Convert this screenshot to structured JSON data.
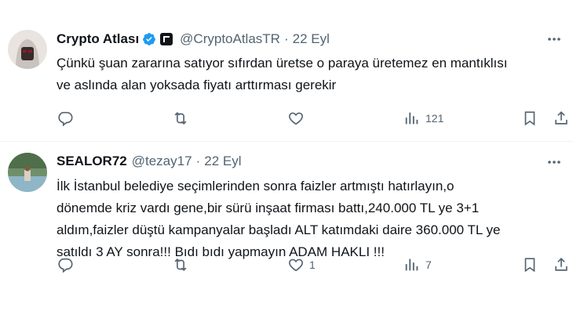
{
  "tweets": [
    {
      "name": "Crypto Atlası",
      "handle": "@CryptoAtlasTR",
      "separator": "·",
      "date": "22 Eyl",
      "text_lines": [
        "Çünkü şuan zararına satıyor sıfırdan üretse o paraya üretemez en mantıklısı",
        "ve aslında alan yoksada fiyatı arttırması gerekir"
      ],
      "verified": true,
      "affiliate_badge": true,
      "actions": {
        "replies": "",
        "retweets": "",
        "likes": "",
        "views": "121"
      }
    },
    {
      "name": "SEALOR72",
      "handle": "@tezay17",
      "separator": "·",
      "date": "22 Eyl",
      "text_lines": [
        "İlk İstanbul belediye seçimlerinden sonra faizler artmıştı hatırlayın,o",
        "dönemde kriz vardı gene,bir sürü inşaat firması battı,240.000 TL ye 3+1",
        "aldım,faizler düştü kampanyalar başladı ALT katımdaki daire 360.000 TL ye",
        "satıldı 3 AY sonra!!! Bıdı bıdı yapmayın ADAM HAKLI !!!"
      ],
      "verified": false,
      "affiliate_badge": false,
      "actions": {
        "replies": "",
        "retweets": "",
        "likes": "1",
        "views": "7"
      }
    }
  ],
  "colors": {
    "text": "#0f1419",
    "muted": "#536471",
    "verified": "#1d9bf0",
    "divider": "#eff3f4"
  },
  "icons": [
    "more-icon",
    "reply-icon",
    "retweet-icon",
    "like-icon",
    "views-icon",
    "bookmark-icon",
    "share-icon",
    "verified-icon"
  ]
}
